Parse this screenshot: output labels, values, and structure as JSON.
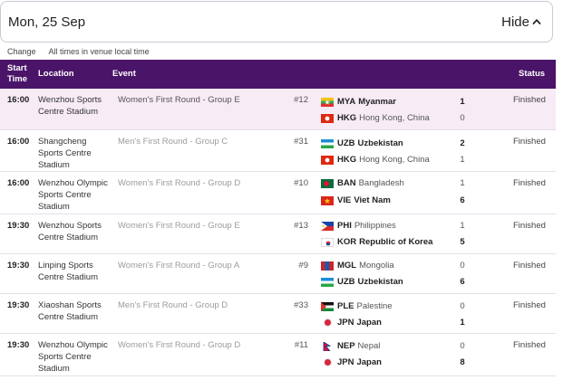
{
  "date_bar": {
    "date": "Mon, 25 Sep",
    "toggle_label": "Hide"
  },
  "meta": {
    "change_label": "Change",
    "timezone_note": "All times in venue local time"
  },
  "header": {
    "start_time": "Start Time",
    "location": "Location",
    "event": "Event",
    "status": "Status"
  },
  "colors": {
    "header_bg": "#4a1569",
    "highlight_row": "#f7ebf6"
  },
  "matches": [
    {
      "time": "16:00",
      "location": "Wenzhou Sports Centre Stadium",
      "event": "Women's First Round - Group E",
      "match_no": "#12",
      "status": "Finished",
      "team1": {
        "flag": "mya-flag",
        "code": "MYA",
        "name": "Myanmar",
        "score": "1"
      },
      "team2": {
        "flag": "hkg-flag",
        "code": "HKG",
        "name": "Hong Kong, China",
        "score": "0"
      }
    },
    {
      "time": "16:00",
      "location": "Shangcheng Sports Centre Stadium",
      "event": "Men's First Round - Group C",
      "match_no": "#31",
      "status": "Finished",
      "team1": {
        "flag": "uzb-flag",
        "code": "UZB",
        "name": "Uzbekistan",
        "score": "2"
      },
      "team2": {
        "flag": "hkg-flag",
        "code": "HKG",
        "name": "Hong Kong, China",
        "score": "1"
      }
    },
    {
      "time": "16:00",
      "location": "Wenzhou Olympic Sports Centre Stadium",
      "event": "Women's First Round - Group D",
      "match_no": "#10",
      "status": "Finished",
      "team1": {
        "flag": "ban-flag",
        "code": "BAN",
        "name": "Bangladesh",
        "score": "1"
      },
      "team2": {
        "flag": "vie-flag",
        "code": "VIE",
        "name": "Viet Nam",
        "score": "6"
      }
    },
    {
      "time": "19:30",
      "location": "Wenzhou Sports Centre Stadium",
      "event": "Women's First Round - Group E",
      "match_no": "#13",
      "status": "Finished",
      "team1": {
        "flag": "phi-flag",
        "code": "PHI",
        "name": "Philippines",
        "score": "1"
      },
      "team2": {
        "flag": "kor-flag",
        "code": "KOR",
        "name": "Republic of Korea",
        "score": "5"
      }
    },
    {
      "time": "19:30",
      "location": "Linping Sports Centre Stadium",
      "event": "Women's First Round - Group A",
      "match_no": "#9",
      "status": "Finished",
      "team1": {
        "flag": "mgl-flag",
        "code": "MGL",
        "name": "Mongolia",
        "score": "0"
      },
      "team2": {
        "flag": "uzb-flag",
        "code": "UZB",
        "name": "Uzbekistan",
        "score": "6"
      }
    },
    {
      "time": "19:30",
      "location": "Xiaoshan Sports Centre Stadium",
      "event": "Men's First Round - Group D",
      "match_no": "#33",
      "status": "Finished",
      "team1": {
        "flag": "ple-flag",
        "code": "PLE",
        "name": "Palestine",
        "score": "0"
      },
      "team2": {
        "flag": "jpn-flag",
        "code": "JPN",
        "name": "Japan",
        "score": "1"
      }
    },
    {
      "time": "19:30",
      "location": "Wenzhou Olympic Sports Centre Stadium",
      "event": "Women's First Round - Group D",
      "match_no": "#11",
      "status": "Finished",
      "team1": {
        "flag": "nep-flag",
        "code": "NEP",
        "name": "Nepal",
        "score": "0"
      },
      "team2": {
        "flag": "jpn-flag",
        "code": "JPN",
        "name": "Japan",
        "score": "8"
      }
    }
  ]
}
